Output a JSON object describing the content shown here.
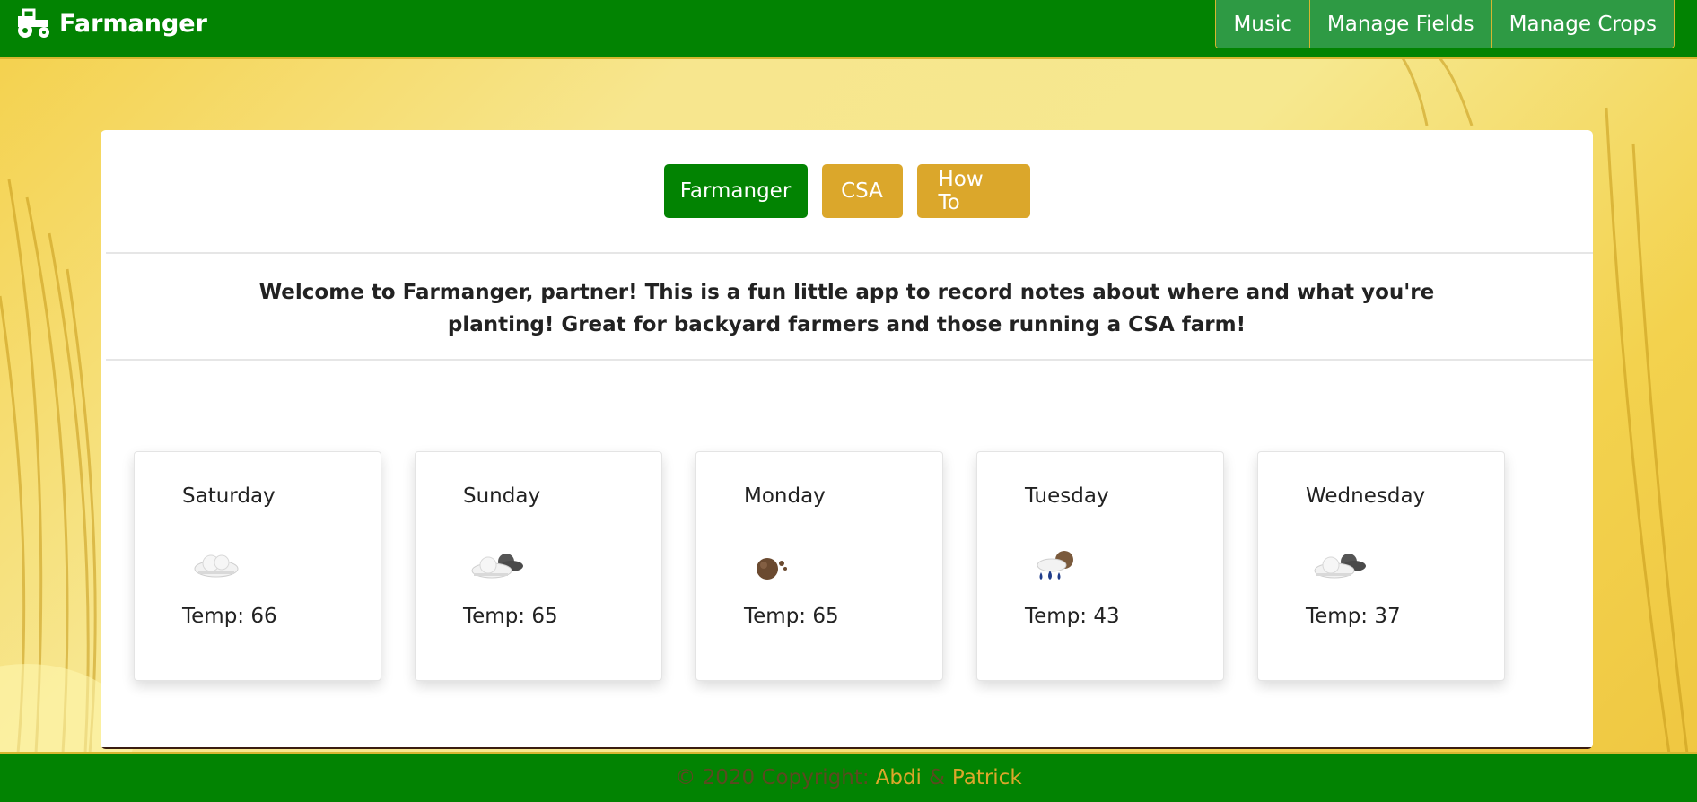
{
  "navbar": {
    "brand": "Farmanger",
    "brand_icon": "tractor-icon",
    "menu": [
      {
        "label": "Music"
      },
      {
        "label": "Manage Fields"
      },
      {
        "label": "Manage Crops"
      }
    ]
  },
  "tabs": [
    {
      "label": "Farmanger",
      "active": true
    },
    {
      "label": "CSA",
      "active": false
    },
    {
      "label": "How To",
      "active": false
    }
  ],
  "welcome": "Welcome to Farmanger, partner! This is a fun little app to record notes about where and what you're planting! Great for backyard farmers and those running a CSA farm!",
  "forecast": [
    {
      "day": "Saturday",
      "icon": "cloud-icon",
      "temp": "Temp: 66"
    },
    {
      "day": "Sunday",
      "icon": "cloud-dark-icon",
      "temp": "Temp: 65"
    },
    {
      "day": "Monday",
      "icon": "dust-icon",
      "temp": "Temp: 65"
    },
    {
      "day": "Tuesday",
      "icon": "rain-icon",
      "temp": "Temp: 43"
    },
    {
      "day": "Wednesday",
      "icon": "cloud-dark-icon",
      "temp": "Temp: 37"
    }
  ],
  "footer": {
    "prefix": "© 2020 Copyright:",
    "author1": "Abdi",
    "amp": "&",
    "author2": "Patrick"
  },
  "colors": {
    "primary_green": "#028302",
    "gold": "#dba72b",
    "nav_item_green": "#2e9a44"
  }
}
